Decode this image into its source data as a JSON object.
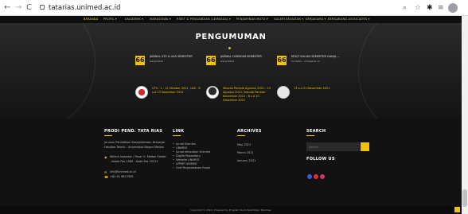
{
  "browser": {
    "url": "tatarias.unimed.ac.id",
    "back_glyph": "←",
    "forward_glyph": "→",
    "reload_glyph": "C"
  },
  "nav": {
    "items": [
      {
        "label": "BERANDA",
        "active": true
      },
      {
        "label": "PROFIL ▾"
      },
      {
        "label": "AKADEMIK ▾"
      },
      {
        "label": "MAHASISWA ▾"
      },
      {
        "label": "RISET & PENGABDIAN (LEMBAGA) ▾"
      },
      {
        "label": "PENJAMINAN MUTU ▾"
      },
      {
        "label": "GALERI KEGIATAN ▾"
      },
      {
        "label": "KERJASAMA ▾"
      },
      {
        "label": "BERGABUNG ASSOCIATES ▾"
      }
    ]
  },
  "hero": {
    "title": "PENGUMUMAN",
    "quote_glyph": "66",
    "cards": [
      {
        "title": "JADWAL UTS & UAS SEMESTER",
        "sub": "Ganjil 2021"
      },
      {
        "title": "JADWAL YUDISIUM SEMESTER",
        "sub": "Ganjil 2021"
      },
      {
        "title": "KRS/T KULIAH SEMESTER GANJIL ...",
        "sub": "T.A 2021 - unimed.ac.id"
      }
    ],
    "posts": [
      {
        "text": "UTS : 1 - 11 Oktober 2021, UAS : 6 s.d 13 Desember 2021"
      },
      {
        "text": "Wisuda Periode Agustus 2021 : 23 Agustus 2021, Wisuda Periode November 2021 : 8 s.d 10 Desember 2021"
      },
      {
        "text": "13 s.d 21 Desember 2021"
      }
    ]
  },
  "footer": {
    "about": {
      "heading": "PRODI PEND. TATA RIAS",
      "desc": "Jurusan Pendidikan Kesejahteraan Keluarga Fakultas Teknik - Universitas Negeri Medan",
      "address": "Willem Iskandar / Pasar V, Medan Estate - Kotak Pos 1589 - Kode Pos 20221",
      "email": "info@unimed.ac.id",
      "phone": "+62 61 6613365"
    },
    "links": {
      "heading": "LINK",
      "items": [
        "Jurnal Ekonika",
        "UNIMED",
        "Jurnal education Unimed",
        "Digilib Repository",
        "Website UNIMED",
        "LPPMP UNIMED",
        "Unit Perpustakaan Pusat"
      ]
    },
    "archives": {
      "heading": "ARCHIVES",
      "items": [
        "May 2021",
        "March 2021",
        "January 2021"
      ]
    },
    "search": {
      "heading": "SEARCH",
      "placeholder": "Search",
      "follow_heading": "FOLLOW US"
    },
    "copyright": "Copyright © 2021 | Powered by Program Studi Pendidikan Tata Rias"
  }
}
